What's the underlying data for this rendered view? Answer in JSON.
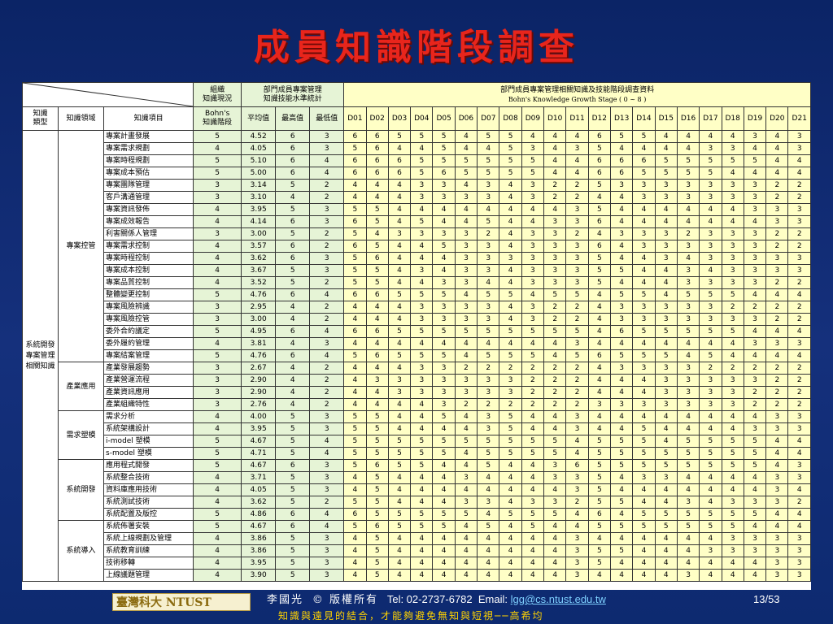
{
  "title": "成員知識階段調查",
  "header": {
    "org_status": "組織\n知識現況",
    "dept_member": "部門成員專案管理\n知識技能水準統計",
    "dept_survey": "部門成員專案管理相關知識及技能階段調查資料",
    "bohn_stage": "Bohn's Knowledge Growth Stage ( 0 ~ 8 )",
    "col_type": "知識\n類型",
    "col_domain": "知識領域",
    "col_item": "知識項目",
    "col_bohn": "Bohn's\n知識階段",
    "col_avg": "平均值",
    "col_max": "最高值",
    "col_min": "最低值",
    "members": [
      "D01",
      "D02",
      "D03",
      "D04",
      "D05",
      "D06",
      "D07",
      "D08",
      "D09",
      "D10",
      "D11",
      "D12",
      "D13",
      "D14",
      "D15",
      "D16",
      "D17",
      "D18",
      "D19",
      "D20",
      "D21"
    ]
  },
  "knowledge_type": "系統開發\n專案管理\n相關知識",
  "groups": [
    {
      "domain": "專案控管",
      "rows": [
        [
          "專案計畫發展",
          "5",
          "4.52",
          "6",
          "3",
          [
            6,
            6,
            5,
            5,
            5,
            4,
            5,
            5,
            4,
            4,
            4,
            6,
            5,
            5,
            4,
            4,
            4,
            4,
            3,
            4,
            3
          ]
        ],
        [
          "專案需求規劃",
          "4",
          "4.05",
          "6",
          "3",
          [
            5,
            6,
            4,
            4,
            5,
            4,
            4,
            5,
            3,
            4,
            3,
            5,
            4,
            4,
            4,
            4,
            3,
            3,
            4,
            4,
            3
          ]
        ],
        [
          "專案時程規劃",
          "5",
          "5.10",
          "6",
          "4",
          [
            6,
            6,
            6,
            5,
            5,
            5,
            5,
            5,
            5,
            4,
            4,
            6,
            6,
            6,
            5,
            5,
            5,
            5,
            5,
            4,
            4
          ]
        ],
        [
          "專案成本預估",
          "5",
          "5.00",
          "6",
          "4",
          [
            6,
            6,
            6,
            5,
            6,
            5,
            5,
            5,
            5,
            4,
            4,
            6,
            6,
            5,
            5,
            5,
            5,
            4,
            4,
            4,
            4
          ]
        ],
        [
          "專案團隊管理",
          "3",
          "3.14",
          "5",
          "2",
          [
            4,
            4,
            4,
            3,
            3,
            4,
            3,
            4,
            3,
            2,
            2,
            5,
            3,
            3,
            3,
            3,
            3,
            3,
            3,
            2,
            2
          ]
        ],
        [
          "客戶溝通管理",
          "3",
          "3.10",
          "4",
          "2",
          [
            4,
            4,
            4,
            3,
            3,
            3,
            3,
            4,
            3,
            2,
            2,
            4,
            4,
            3,
            3,
            3,
            3,
            3,
            3,
            2,
            2
          ]
        ],
        [
          "專案資訊發佈",
          "4",
          "3.95",
          "5",
          "3",
          [
            5,
            5,
            4,
            4,
            4,
            4,
            4,
            4,
            4,
            4,
            3,
            5,
            4,
            4,
            4,
            4,
            4,
            4,
            3,
            3,
            3
          ]
        ],
        [
          "專案成效報告",
          "4",
          "4.14",
          "6",
          "3",
          [
            6,
            5,
            4,
            5,
            4,
            4,
            5,
            4,
            4,
            3,
            3,
            6,
            4,
            4,
            4,
            4,
            4,
            4,
            4,
            3,
            3
          ]
        ],
        [
          "利害關係人管理",
          "3",
          "3.00",
          "5",
          "2",
          [
            5,
            4,
            3,
            3,
            3,
            3,
            2,
            4,
            3,
            3,
            2,
            4,
            3,
            3,
            3,
            2,
            3,
            3,
            3,
            2,
            2
          ]
        ],
        [
          "專案需求控制",
          "4",
          "3.57",
          "6",
          "2",
          [
            6,
            5,
            4,
            4,
            5,
            3,
            3,
            4,
            3,
            3,
            3,
            6,
            4,
            3,
            3,
            3,
            3,
            3,
            3,
            2,
            2
          ]
        ],
        [
          "專案時程控制",
          "4",
          "3.62",
          "6",
          "3",
          [
            5,
            6,
            4,
            4,
            4,
            3,
            3,
            3,
            3,
            3,
            3,
            5,
            4,
            4,
            3,
            4,
            3,
            3,
            3,
            3,
            3
          ]
        ],
        [
          "專案成本控制",
          "4",
          "3.67",
          "5",
          "3",
          [
            5,
            5,
            4,
            3,
            4,
            3,
            3,
            4,
            3,
            3,
            3,
            5,
            5,
            4,
            4,
            3,
            4,
            3,
            3,
            3,
            3
          ]
        ],
        [
          "專案品質控制",
          "4",
          "3.52",
          "5",
          "2",
          [
            5,
            5,
            4,
            4,
            3,
            3,
            4,
            4,
            3,
            3,
            3,
            5,
            4,
            4,
            4,
            3,
            3,
            3,
            3,
            2,
            2
          ]
        ],
        [
          "整體變更控制",
          "5",
          "4.76",
          "6",
          "4",
          [
            6,
            6,
            5,
            5,
            5,
            4,
            5,
            5,
            4,
            5,
            5,
            4,
            5,
            5,
            4,
            5,
            5,
            5,
            4,
            4,
            4
          ]
        ],
        [
          "專案風險辨識",
          "3",
          "2.95",
          "4",
          "2",
          [
            4,
            4,
            4,
            3,
            3,
            3,
            3,
            4,
            3,
            2,
            2,
            4,
            3,
            3,
            3,
            3,
            3,
            2,
            2,
            2,
            2
          ]
        ],
        [
          "專案風險控管",
          "3",
          "3.00",
          "4",
          "2",
          [
            4,
            4,
            4,
            3,
            3,
            3,
            3,
            4,
            3,
            2,
            2,
            4,
            3,
            3,
            3,
            3,
            3,
            3,
            3,
            2,
            2
          ]
        ],
        [
          "委外合約議定",
          "5",
          "4.95",
          "6",
          "4",
          [
            6,
            6,
            5,
            5,
            5,
            5,
            5,
            5,
            5,
            5,
            5,
            4,
            6,
            5,
            5,
            5,
            5,
            5,
            4,
            4,
            4
          ]
        ],
        [
          "委外履約管理",
          "4",
          "3.81",
          "4",
          "3",
          [
            4,
            4,
            4,
            4,
            4,
            4,
            4,
            4,
            4,
            4,
            3,
            4,
            4,
            4,
            4,
            4,
            4,
            4,
            3,
            3,
            3
          ]
        ],
        [
          "專案結案管理",
          "5",
          "4.76",
          "6",
          "4",
          [
            5,
            6,
            5,
            5,
            5,
            4,
            5,
            5,
            5,
            4,
            5,
            6,
            5,
            5,
            5,
            4,
            5,
            4,
            4,
            4,
            4
          ]
        ]
      ]
    },
    {
      "domain": "產業應用",
      "rows": [
        [
          "產業發展趨勢",
          "3",
          "2.67",
          "4",
          "2",
          [
            4,
            4,
            4,
            3,
            3,
            2,
            2,
            2,
            2,
            2,
            2,
            4,
            3,
            3,
            3,
            3,
            2,
            2,
            2,
            2,
            2
          ]
        ],
        [
          "產業營運流程",
          "3",
          "2.90",
          "4",
          "2",
          [
            4,
            3,
            3,
            3,
            3,
            3,
            3,
            3,
            2,
            2,
            2,
            4,
            4,
            4,
            3,
            3,
            3,
            3,
            3,
            2,
            2
          ]
        ],
        [
          "產業資訊應用",
          "3",
          "2.90",
          "4",
          "2",
          [
            4,
            4,
            3,
            3,
            3,
            3,
            3,
            3,
            2,
            2,
            2,
            4,
            4,
            4,
            3,
            3,
            3,
            3,
            2,
            2,
            2
          ]
        ],
        [
          "產業組織特性",
          "3",
          "2.76",
          "4",
          "2",
          [
            4,
            4,
            4,
            4,
            3,
            2,
            2,
            2,
            2,
            2,
            2,
            3,
            3,
            3,
            3,
            3,
            3,
            3,
            2,
            2,
            2
          ]
        ]
      ]
    },
    {
      "domain": "需求塑模",
      "rows": [
        [
          "需求分析",
          "4",
          "4.00",
          "5",
          "3",
          [
            5,
            5,
            4,
            4,
            5,
            4,
            3,
            5,
            4,
            4,
            3,
            4,
            4,
            4,
            4,
            4,
            4,
            4,
            4,
            3,
            3
          ]
        ],
        [
          "系統架構設計",
          "4",
          "3.95",
          "5",
          "3",
          [
            5,
            5,
            4,
            4,
            4,
            4,
            3,
            5,
            4,
            4,
            3,
            4,
            4,
            5,
            4,
            4,
            4,
            4,
            3,
            3,
            3
          ]
        ],
        [
          "i-model 塑模",
          "5",
          "4.67",
          "5",
          "4",
          [
            5,
            5,
            5,
            5,
            5,
            5,
            5,
            5,
            5,
            5,
            4,
            5,
            5,
            5,
            4,
            5,
            5,
            5,
            5,
            4,
            4
          ]
        ],
        [
          "s-model 塑模",
          "5",
          "4.71",
          "5",
          "4",
          [
            5,
            5,
            5,
            5,
            5,
            4,
            5,
            5,
            5,
            5,
            4,
            5,
            5,
            5,
            5,
            5,
            5,
            5,
            5,
            4,
            4
          ]
        ]
      ]
    },
    {
      "domain": "系統開發",
      "rows": [
        [
          "應用程式開發",
          "5",
          "4.67",
          "6",
          "3",
          [
            5,
            6,
            5,
            5,
            4,
            4,
            5,
            4,
            4,
            3,
            6,
            5,
            5,
            5,
            5,
            5,
            5,
            5,
            5,
            4,
            3
          ]
        ],
        [
          "系統整合技術",
          "4",
          "3.71",
          "5",
          "3",
          [
            4,
            5,
            4,
            4,
            4,
            3,
            4,
            4,
            4,
            3,
            3,
            5,
            4,
            3,
            3,
            4,
            4,
            4,
            4,
            3,
            3
          ]
        ],
        [
          "資料庫應用技術",
          "4",
          "4.05",
          "5",
          "3",
          [
            4,
            5,
            4,
            4,
            4,
            4,
            4,
            4,
            4,
            4,
            3,
            5,
            4,
            4,
            4,
            4,
            4,
            4,
            4,
            3,
            4
          ]
        ],
        [
          "系統測試技術",
          "4",
          "3.62",
          "5",
          "2",
          [
            5,
            5,
            4,
            4,
            4,
            3,
            3,
            4,
            3,
            3,
            2,
            5,
            5,
            4,
            4,
            3,
            4,
            3,
            3,
            3,
            2
          ]
        ],
        [
          "系統配置及版控",
          "5",
          "4.86",
          "6",
          "4",
          [
            6,
            5,
            5,
            5,
            5,
            5,
            4,
            5,
            5,
            5,
            4,
            6,
            4,
            5,
            5,
            5,
            5,
            5,
            5,
            4,
            4
          ]
        ]
      ]
    },
    {
      "domain": "系統導入",
      "rows": [
        [
          "系統佈署安裝",
          "5",
          "4.67",
          "6",
          "4",
          [
            5,
            6,
            5,
            5,
            5,
            4,
            5,
            4,
            5,
            4,
            4,
            5,
            5,
            5,
            5,
            5,
            5,
            5,
            4,
            4,
            4
          ]
        ],
        [
          "系統上線規劃及管理",
          "4",
          "3.86",
          "5",
          "3",
          [
            4,
            5,
            4,
            4,
            4,
            4,
            4,
            4,
            4,
            4,
            3,
            4,
            4,
            4,
            4,
            4,
            4,
            3,
            3,
            3,
            3
          ]
        ],
        [
          "系統教育訓練",
          "4",
          "3.86",
          "5",
          "3",
          [
            4,
            5,
            4,
            4,
            4,
            4,
            4,
            4,
            4,
            4,
            3,
            5,
            5,
            4,
            4,
            4,
            3,
            3,
            3,
            3,
            3
          ]
        ],
        [
          "技術移轉",
          "4",
          "3.95",
          "5",
          "3",
          [
            4,
            5,
            4,
            4,
            4,
            4,
            4,
            4,
            4,
            4,
            3,
            5,
            4,
            4,
            4,
            4,
            4,
            4,
            4,
            3,
            3
          ]
        ],
        [
          "上線議題管理",
          "4",
          "3.90",
          "5",
          "3",
          [
            4,
            5,
            4,
            4,
            4,
            4,
            4,
            4,
            4,
            4,
            3,
            4,
            4,
            4,
            4,
            3,
            4,
            4,
            4,
            3,
            3
          ]
        ]
      ]
    }
  ],
  "footer": {
    "logo_text": "臺灣科大 NTUST",
    "author": "李國光",
    "copyright": "© 版權所有",
    "tel": "Tel: 02-2737-6782",
    "email_label": "Email:",
    "email": "lgg@cs.ntust.edu.tw",
    "page": "13/53",
    "motto": "知識與遠見的結合，才能夠避免無知與短視──高希均"
  }
}
